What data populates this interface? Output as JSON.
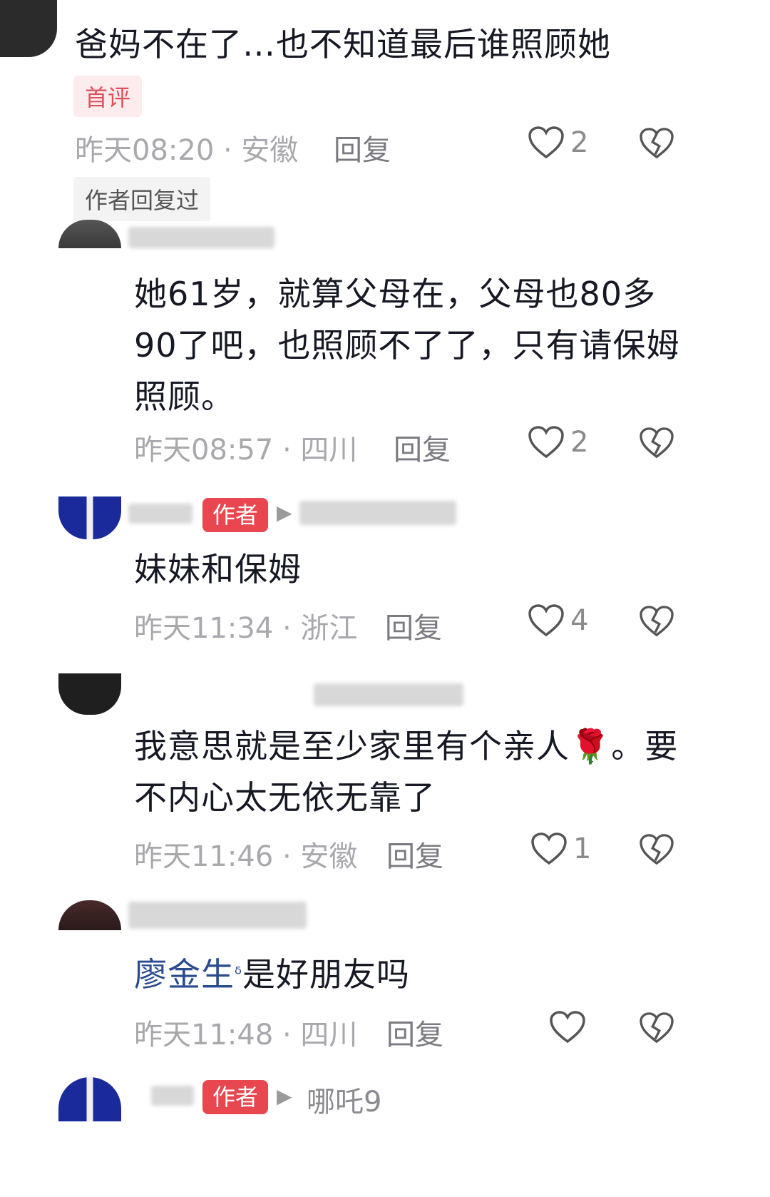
{
  "comments": [
    {
      "text": "爸妈不在了…也不知道最后谁照顾她",
      "tag": "首评",
      "meta": "昨天08:20 · 安徽",
      "reply": "回复",
      "likes": "2",
      "sub_tag": "作者回复过"
    },
    {
      "text": "她61岁，就算父母在，父母也80多90了吧，也照顾不了了，只有请保姆照顾。",
      "meta": "昨天08:57 · 四川",
      "reply": "回复",
      "likes": "2"
    },
    {
      "author_tag": "作者",
      "text": "妹妹和保姆",
      "meta": "昨天11:34 · 浙江",
      "reply": "回复",
      "likes": "4"
    },
    {
      "text": "我意思就是至少家里有个亲人🌹。要不内心太无依无靠了",
      "meta": "昨天11:46 · 安徽",
      "reply": "回复",
      "likes": "1"
    },
    {
      "mention": "廖金生",
      "text": "是好朋友吗",
      "meta": "昨天11:48 · 四川",
      "reply": "回复",
      "likes": ""
    },
    {
      "author_tag": "作者",
      "reply_to": "哪吒9"
    }
  ],
  "colors": {
    "author_tag": "#e8474f",
    "first_tag_bg": "#fdecee",
    "mention": "#2a4b8d",
    "meta": "#a8a8ad"
  },
  "icons": [
    "heart-icon",
    "dislike-icon",
    "reply-arrow-icon",
    "search-icon"
  ]
}
